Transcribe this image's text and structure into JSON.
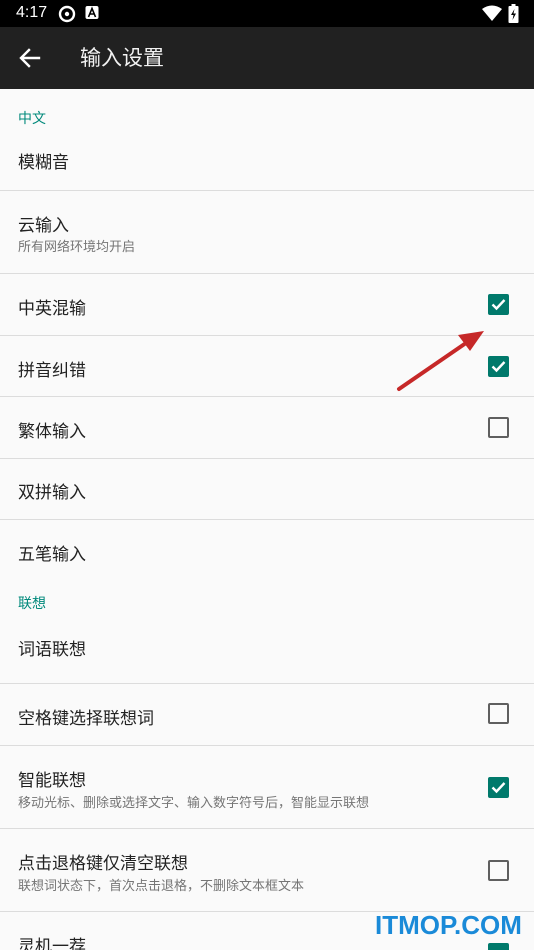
{
  "status_bar": {
    "time": "4:17"
  },
  "app_bar": {
    "title": "输入设置"
  },
  "sections": [
    {
      "category": "中文"
    },
    {
      "category": "联想"
    }
  ],
  "items": [
    {
      "title": "模糊音"
    },
    {
      "title": "云输入",
      "summary": "所有网络环境均开启"
    },
    {
      "title": "中英混输",
      "checked": true
    },
    {
      "title": "拼音纠错",
      "checked": true
    },
    {
      "title": "繁体输入",
      "checked": false
    },
    {
      "title": "双拼输入"
    },
    {
      "title": "五笔输入"
    },
    {
      "title": "词语联想"
    },
    {
      "title": "空格键选择联想词",
      "checked": false
    },
    {
      "title": "智能联想",
      "summary": "移动光标、删除或选择文字、输入数字符号后，智能显示联想",
      "checked": true
    },
    {
      "title": "点击退格键仅清空联想",
      "summary": "联想词状态下，首次点击退格，不删除文本框文本",
      "checked": false
    },
    {
      "title": "灵机一荐",
      "checked": true
    }
  ],
  "watermark": "ITMOP.COM",
  "colors": {
    "accent": "#00796b",
    "category": "#00897b",
    "appbar": "#212121",
    "annotation_arrow": "#d32f2f"
  }
}
